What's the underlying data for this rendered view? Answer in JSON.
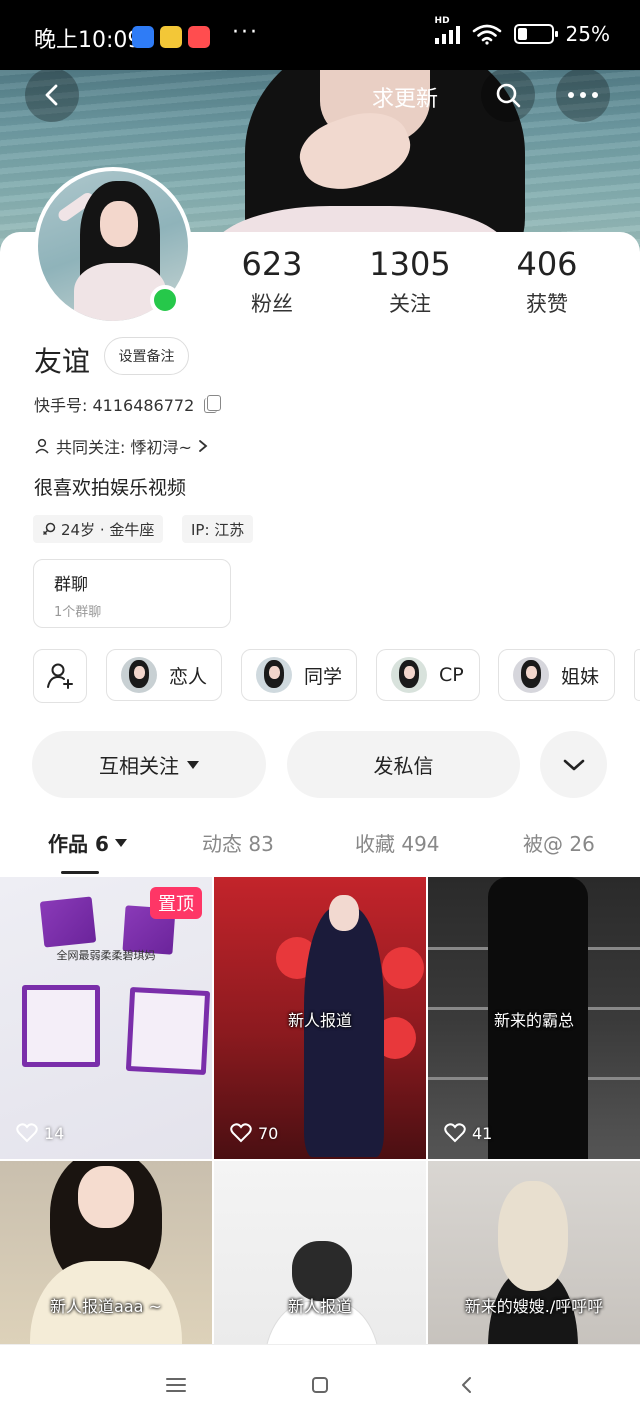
{
  "status_bar": {
    "time": "晚上10:09",
    "dots": "···",
    "battery": "25%",
    "network_label": "HD",
    "icons": [
      "chat-app-icon",
      "mini-app-icon",
      "kuaishou-app-icon",
      "signal-icon",
      "wifi-icon",
      "battery-icon"
    ]
  },
  "header": {
    "title": "求更新",
    "icons": [
      "back-icon",
      "search-icon",
      "more-icon"
    ]
  },
  "stats": [
    {
      "value": "623",
      "label": "粉丝"
    },
    {
      "value": "1305",
      "label": "关注"
    },
    {
      "value": "406",
      "label": "获赞"
    }
  ],
  "profile": {
    "name": "友谊",
    "remark_button": "设置备注",
    "id_text": "快手号: 4116486772",
    "mutual_text": "共同关注: 悸初浔~",
    "bio": "很喜欢拍娱乐视频",
    "tags": [
      "24岁 · 金牛座",
      "IP: 江苏"
    ],
    "online_color": "#26c84a"
  },
  "group": {
    "title": "群聊",
    "subtitle": "1个群聊"
  },
  "relations": [
    "恋人",
    "同学",
    "CP",
    "姐妹"
  ],
  "actions": {
    "follow": "互相关注",
    "message": "发私信"
  },
  "tabs": [
    {
      "label": "作品 6",
      "active": true
    },
    {
      "label": "动态 83",
      "active": false
    },
    {
      "label": "收藏 494",
      "active": false
    },
    {
      "label": "被@ 26",
      "active": false
    }
  ],
  "videos": [
    {
      "caption": "全网最弱柔柔碧琪妈",
      "likes": "14",
      "pinned": "置顶"
    },
    {
      "caption": "新人报道",
      "likes": "70"
    },
    {
      "caption": "新来的霸总",
      "likes": "41"
    },
    {
      "caption": "新人报道aaa ~"
    },
    {
      "caption": "新人报道"
    },
    {
      "caption": "新来的嫂嫂./呼呼呼"
    }
  ],
  "colors": {
    "accent_pink": "#fe3666",
    "online_green": "#26c84a"
  }
}
